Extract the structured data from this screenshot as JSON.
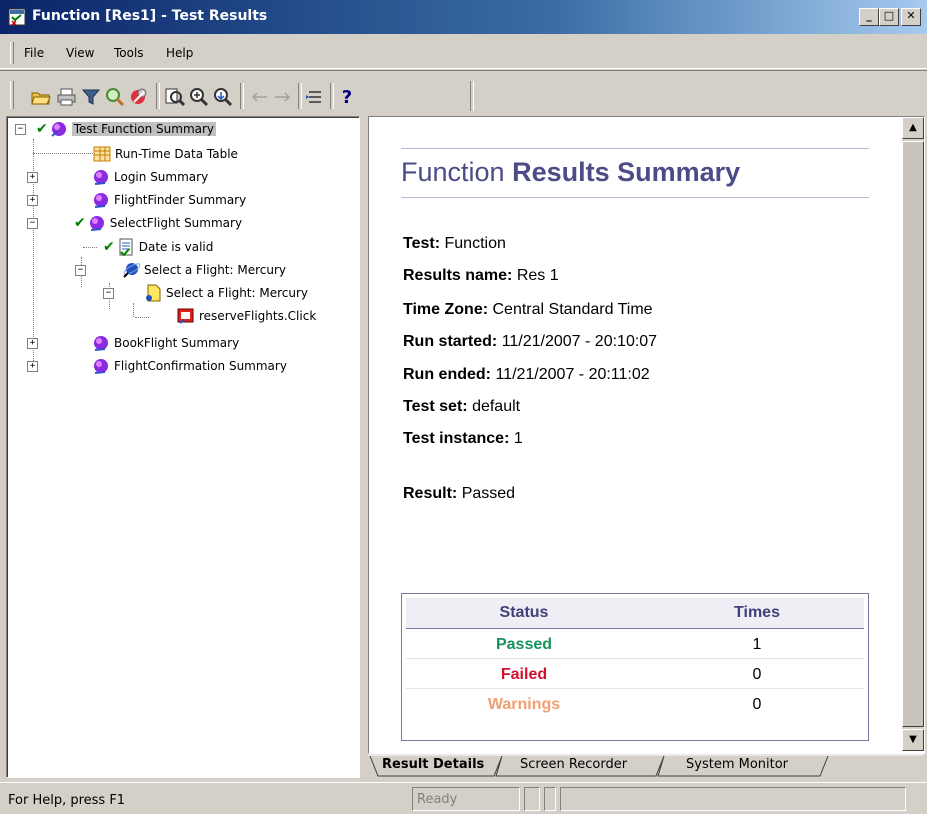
{
  "window": {
    "title": "Function [Res1] - Test Results",
    "minimize_label": "_",
    "restore_label": "□",
    "close_label": "✕"
  },
  "menu": {
    "items": [
      {
        "label": "File",
        "name": "menu-file"
      },
      {
        "label": "View",
        "name": "menu-view"
      },
      {
        "label": "Tools",
        "name": "menu-tools"
      },
      {
        "label": "Help",
        "name": "menu-help"
      }
    ]
  },
  "toolbar": {
    "help_glyph": "?"
  },
  "tree": {
    "root": "Test Function Summary",
    "items": [
      "Run-Time Data Table",
      "Login Summary",
      "FlightFinder Summary",
      "SelectFlight Summary",
      "Date is valid",
      "Select a Flight: Mercury",
      "Select a Flight: Mercury",
      "reserveFlights.Click",
      "BookFlight Summary",
      "FlightConfirmation Summary"
    ],
    "expander_plus": "+",
    "expander_minus": "−"
  },
  "report": {
    "title_prefix": "Function",
    "title_rest": "Results Summary",
    "fields": {
      "test_label": "Test:",
      "test_value": "Function",
      "results_name_label": "Results name:",
      "results_name_value": "Res 1",
      "time_zone_label": "Time Zone:",
      "time_zone_value": "Central Standard Time",
      "run_started_label": "Run started:",
      "run_started_value": "11/21/2007 - 20:10:07",
      "run_ended_label": "Run ended:",
      "run_ended_value": "11/21/2007 - 20:11:02",
      "test_set_label": "Test set:",
      "test_set_value": "default",
      "test_instance_label": "Test instance:",
      "test_instance_value": "1",
      "result_label": "Result:",
      "result_value": "Passed"
    },
    "status_table": {
      "headers": {
        "status": "Status",
        "times": "Times"
      },
      "rows": [
        {
          "status": "Passed",
          "times": "1"
        },
        {
          "status": "Failed",
          "times": "0"
        },
        {
          "status": "Warnings",
          "times": "0"
        }
      ]
    }
  },
  "tabs": [
    {
      "label": "Result Details",
      "active": true
    },
    {
      "label": "Screen Recorder",
      "active": false
    },
    {
      "label": "System Monitor",
      "active": false
    }
  ],
  "statusbar": {
    "help_text": "For Help, press F1",
    "ready_text": "Ready"
  },
  "colors": {
    "title_accent": "#4c4c86",
    "passed": "#16935c",
    "failed": "#d0102c",
    "warnings": "#f0a070"
  }
}
